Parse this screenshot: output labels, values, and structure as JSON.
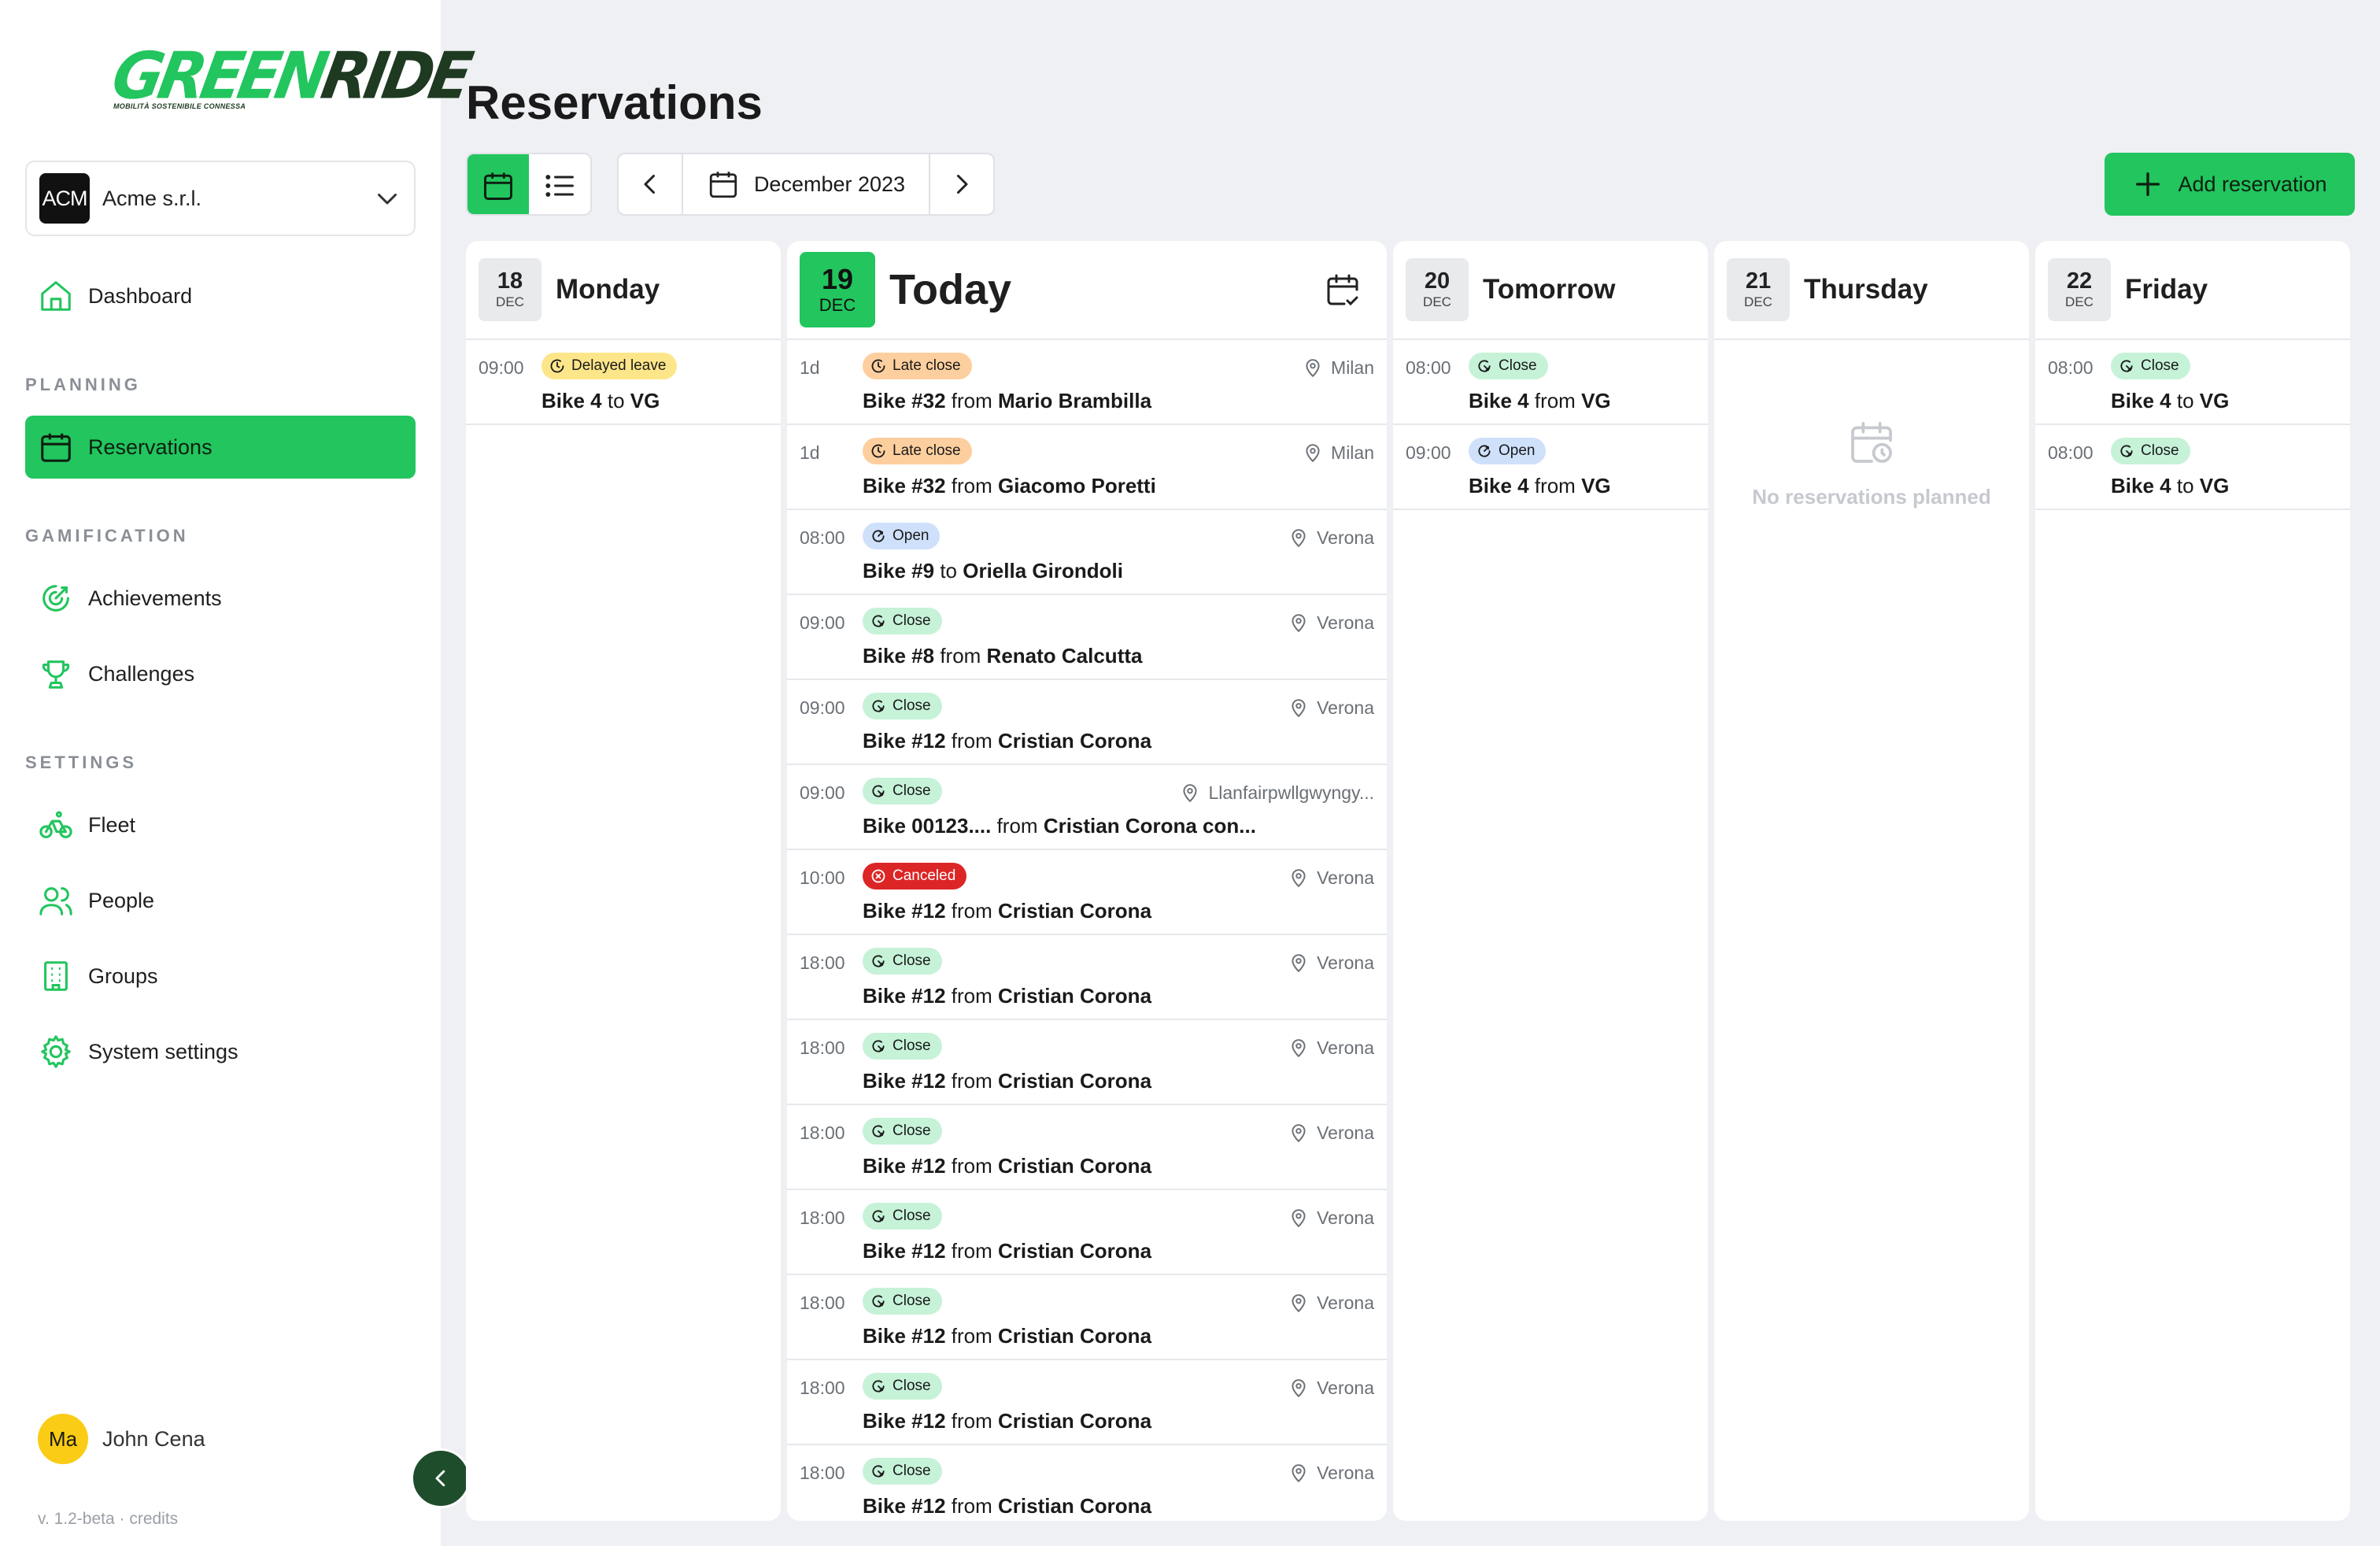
{
  "brand": {
    "logo_green": "GREEN",
    "logo_dark": "RIDE",
    "tagline": "MOBILITÀ SOSTENIBILE CONNESSA",
    "accent": "#22c55e"
  },
  "org": {
    "badge": "ACM",
    "name": "Acme s.r.l."
  },
  "nav": {
    "dashboard": "Dashboard",
    "planning_title": "PLANNING",
    "reservations": "Reservations",
    "gamification_title": "GAMIFICATION",
    "achievements": "Achievements",
    "challenges": "Challenges",
    "settings_title": "SETTINGS",
    "fleet": "Fleet",
    "people": "People",
    "groups": "Groups",
    "system_settings": "System settings"
  },
  "user": {
    "initials": "Ma",
    "name": "John Cena"
  },
  "version": "v. 1.2-beta · credits",
  "page": {
    "title": "Reservations",
    "month": "December 2023",
    "add_label": "Add reservation"
  },
  "days": [
    {
      "day": "18",
      "mon": "DEC",
      "name": "Monday",
      "rows": [
        {
          "time": "09:00",
          "badge": "Delayed leave",
          "kind": "delayed",
          "bike": "Bike 4",
          "prep": "to",
          "who": "VG",
          "loc": ""
        }
      ]
    },
    {
      "day": "19",
      "mon": "DEC",
      "name": "Today",
      "rows": [
        {
          "time": "1d",
          "badge": "Late close",
          "kind": "late",
          "bike": "Bike #32",
          "prep": "from",
          "who": "Mario Brambilla",
          "loc": "Milan"
        },
        {
          "time": "1d",
          "badge": "Late close",
          "kind": "late",
          "bike": "Bike #32",
          "prep": "from",
          "who": "Giacomo Poretti",
          "loc": "Milan"
        },
        {
          "time": "08:00",
          "badge": "Open",
          "kind": "open",
          "bike": "Bike #9",
          "prep": "to",
          "who": "Oriella Girondoli",
          "loc": "Verona"
        },
        {
          "time": "09:00",
          "badge": "Close",
          "kind": "close",
          "bike": "Bike #8",
          "prep": "from",
          "who": "Renato Calcutta",
          "loc": "Verona"
        },
        {
          "time": "09:00",
          "badge": "Close",
          "kind": "close",
          "bike": "Bike #12",
          "prep": "from",
          "who": "Cristian Corona",
          "loc": "Verona"
        },
        {
          "time": "09:00",
          "badge": "Close",
          "kind": "close",
          "bike": "Bike 00123....",
          "prep": "from",
          "who": "Cristian Corona con...",
          "loc": "Llanfairpwllgwyngy..."
        },
        {
          "time": "10:00",
          "badge": "Canceled",
          "kind": "canceled",
          "bike": "Bike #12",
          "prep": "from",
          "who": "Cristian Corona",
          "loc": "Verona"
        },
        {
          "time": "18:00",
          "badge": "Close",
          "kind": "close",
          "bike": "Bike #12",
          "prep": "from",
          "who": "Cristian Corona",
          "loc": "Verona"
        },
        {
          "time": "18:00",
          "badge": "Close",
          "kind": "close",
          "bike": "Bike #12",
          "prep": "from",
          "who": "Cristian Corona",
          "loc": "Verona"
        },
        {
          "time": "18:00",
          "badge": "Close",
          "kind": "close",
          "bike": "Bike #12",
          "prep": "from",
          "who": "Cristian Corona",
          "loc": "Verona"
        },
        {
          "time": "18:00",
          "badge": "Close",
          "kind": "close",
          "bike": "Bike #12",
          "prep": "from",
          "who": "Cristian Corona",
          "loc": "Verona"
        },
        {
          "time": "18:00",
          "badge": "Close",
          "kind": "close",
          "bike": "Bike #12",
          "prep": "from",
          "who": "Cristian Corona",
          "loc": "Verona"
        },
        {
          "time": "18:00",
          "badge": "Close",
          "kind": "close",
          "bike": "Bike #12",
          "prep": "from",
          "who": "Cristian Corona",
          "loc": "Verona"
        },
        {
          "time": "18:00",
          "badge": "Close",
          "kind": "close",
          "bike": "Bike #12",
          "prep": "from",
          "who": "Cristian Corona",
          "loc": "Verona"
        }
      ]
    },
    {
      "day": "20",
      "mon": "DEC",
      "name": "Tomorrow",
      "rows": [
        {
          "time": "08:00",
          "badge": "Close",
          "kind": "close",
          "bike": "Bike 4",
          "prep": "from",
          "who": "VG",
          "loc": ""
        },
        {
          "time": "09:00",
          "badge": "Open",
          "kind": "open",
          "bike": "Bike 4",
          "prep": "from",
          "who": "VG",
          "loc": ""
        }
      ]
    },
    {
      "day": "21",
      "mon": "DEC",
      "name": "Thursday",
      "rows": [],
      "empty": "No reservations planned"
    },
    {
      "day": "22",
      "mon": "DEC",
      "name": "Friday",
      "rows": [
        {
          "time": "08:00",
          "badge": "Close",
          "kind": "close",
          "bike": "Bike 4",
          "prep": "to",
          "who": "VG",
          "loc": ""
        },
        {
          "time": "08:00",
          "badge": "Close",
          "kind": "close",
          "bike": "Bike 4",
          "prep": "to",
          "who": "VG",
          "loc": ""
        }
      ]
    }
  ]
}
